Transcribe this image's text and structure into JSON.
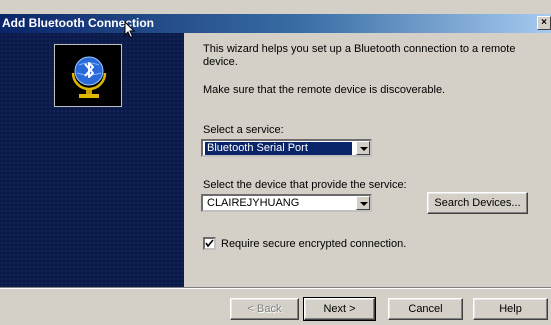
{
  "window": {
    "title": "Add Bluetooth Connection",
    "close_glyph": "×"
  },
  "sidebar": {
    "icon": "bluetooth-globe-icon"
  },
  "content": {
    "intro_text": "This wizard helps you set up a Bluetooth connection to a remote device.",
    "discoverable_text": "Make sure that the remote device is discoverable.",
    "service_label": "Select a service:",
    "service_value": "Bluetooth Serial Port",
    "device_label": "Select the device that provide the service:",
    "device_value": "CLAIREJYHUANG",
    "search_button": "Search Devices...",
    "secure_checkbox_label": "Require secure encrypted connection.",
    "secure_checked": true
  },
  "footer": {
    "back_button": "< Back",
    "next_button": "Next >",
    "cancel_button": "Cancel",
    "help_button": "Help"
  },
  "colors": {
    "title_bar": "#0a246a",
    "sidebar": "#0a1a4a",
    "selection": "#0a246a",
    "face": "#d4d0c8"
  }
}
